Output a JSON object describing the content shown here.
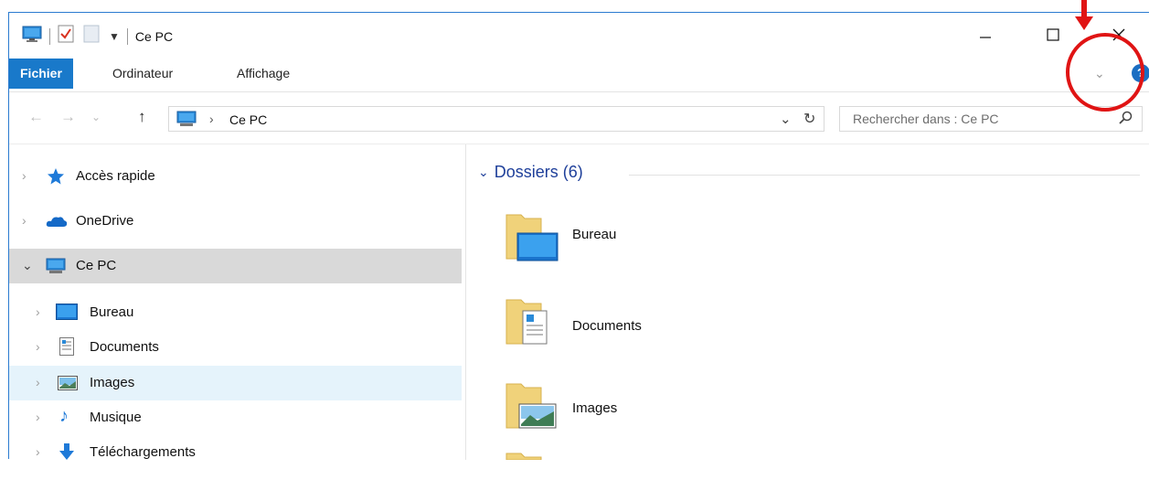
{
  "window": {
    "title": "Ce PC",
    "controls": {
      "minimize": "minimize-icon",
      "maximize": "maximize-icon",
      "close": "close-icon"
    }
  },
  "quick_access": {
    "icons": [
      "computer-icon",
      "properties-icon",
      "new-folder-icon",
      "customize-dropdown-icon"
    ]
  },
  "ribbon": {
    "tabs": [
      {
        "label": "Fichier",
        "active": true
      },
      {
        "label": "Ordinateur"
      },
      {
        "label": "Affichage"
      }
    ]
  },
  "address_bar": {
    "path": "Ce PC",
    "search_placeholder": "Rechercher dans : Ce PC"
  },
  "nav_pane": {
    "items": [
      {
        "label": "Accès rapide",
        "icon": "star-icon"
      },
      {
        "label": "OneDrive",
        "icon": "onedrive-icon"
      },
      {
        "label": "Ce PC",
        "icon": "computer-icon",
        "selected": true
      },
      {
        "label": "Bureau",
        "icon": "desktop-icon"
      },
      {
        "label": "Documents",
        "icon": "documents-icon"
      },
      {
        "label": "Images",
        "icon": "images-icon",
        "hover": true
      },
      {
        "label": "Musique",
        "icon": "music-icon"
      },
      {
        "label": "Téléchargements",
        "icon": "downloads-icon"
      }
    ]
  },
  "content": {
    "group_title": "Dossiers (6)",
    "folders": [
      {
        "label": "Bureau",
        "icon": "desktop-folder-icon"
      },
      {
        "label": "Documents",
        "icon": "documents-folder-icon"
      },
      {
        "label": "Images",
        "icon": "images-folder-icon"
      }
    ]
  },
  "annotation": {
    "color": "#e01414"
  },
  "colors": {
    "accent": "#1979ca",
    "group_title": "#1e3f9a",
    "selected_bg": "#d9d9d9",
    "hover_bg": "#e5f3fb"
  }
}
